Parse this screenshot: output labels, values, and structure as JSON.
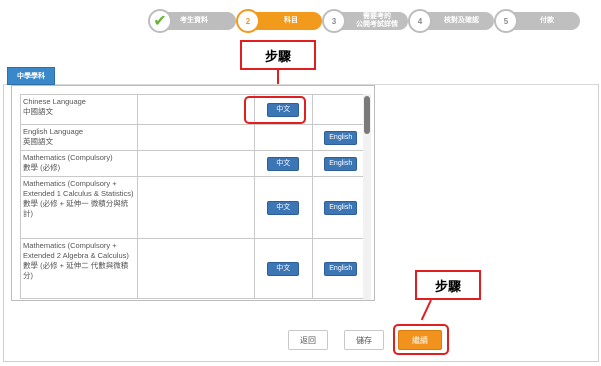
{
  "stepper": {
    "steps": [
      {
        "number": "",
        "label": "考生資料",
        "state": "done"
      },
      {
        "number": "2",
        "label": "科目",
        "state": "active"
      },
      {
        "number": "3",
        "label": "需要考的\n公開考試詳情",
        "state": "pending"
      },
      {
        "number": "4",
        "label": "核對及確認",
        "state": "pending"
      },
      {
        "number": "5",
        "label": "付款",
        "state": "pending"
      }
    ]
  },
  "annotations": {
    "top_label": "步驟",
    "bottom_label": "步驟"
  },
  "tab": {
    "label": "中學學科"
  },
  "subjects": [
    {
      "name_en": "Chinese Language",
      "name_zh": "中國語文",
      "chinese_btn": "中文",
      "english_btn": ""
    },
    {
      "name_en": "English Language",
      "name_zh": "英國語文",
      "chinese_btn": "",
      "english_btn": "English"
    },
    {
      "name_en": "Mathematics (Compulsory)",
      "name_zh": "數學 (必修)",
      "chinese_btn": "中文",
      "english_btn": "English"
    },
    {
      "name_en": "Mathematics (Compulsory + Extended 1 Calculus & Statistics)",
      "name_zh": "數學 (必修 + 延伸一 微積分與統計)",
      "chinese_btn": "中文",
      "english_btn": "English"
    },
    {
      "name_en": "Mathematics (Compulsory + Extended 2 Algebra & Calculus)",
      "name_zh": "數學 (必修 + 延伸二 代數與微積分)",
      "chinese_btn": "中文",
      "english_btn": "English"
    }
  ],
  "footer": {
    "back_label": "返回",
    "save_label": "儲存",
    "continue_label": "繼續"
  },
  "colors": {
    "accent": "#f29a1b",
    "button_blue": "#3c76b5",
    "annotation_red": "#e02020",
    "done_check": "#68b23a"
  }
}
